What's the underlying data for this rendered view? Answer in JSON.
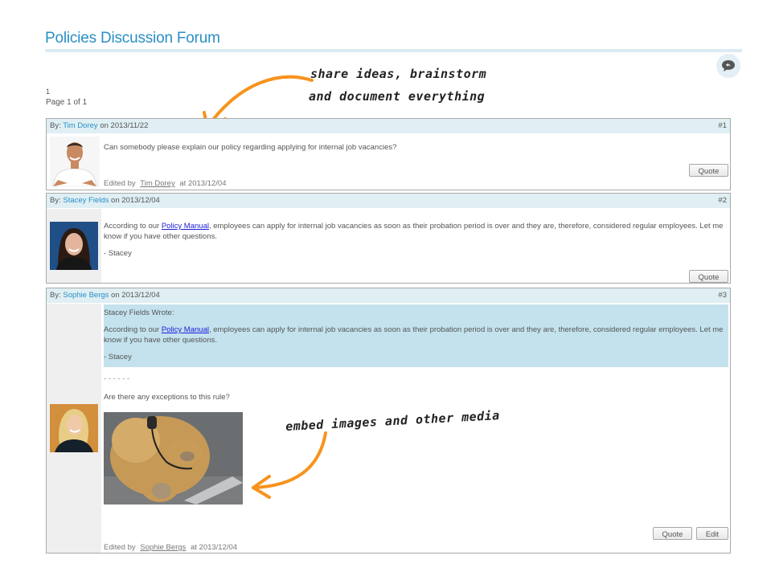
{
  "page": {
    "title": "Policies Discussion Forum",
    "pager_number": "1",
    "pager_text": "Page 1 of 1"
  },
  "annotations": {
    "top_line1": "share ideas, brainstorm",
    "top_line2": "and document everything",
    "bottom": "embed images and other media",
    "arrow_color": "#f7931e"
  },
  "colors": {
    "accent": "#2a8fc6",
    "header_bg": "#dfeff4",
    "quote_bg": "#c3e2ed",
    "link": "#1a1ad8"
  },
  "posts": [
    {
      "by_label": "By:",
      "author": "Tim Dorey",
      "on_label": "on",
      "date": "2013/11/22",
      "number": "#1",
      "body": "Can somebody please explain our policy regarding applying for internal job vacancies?",
      "edited_label": "Edited by",
      "edited_by": "Tim Dorey",
      "edited_at_label": "at",
      "edited_at": "2013/12/04",
      "buttons": [
        "Quote"
      ]
    },
    {
      "by_label": "By:",
      "author": "Stacey Fields",
      "on_label": "on",
      "date": "2013/12/04",
      "number": "#2",
      "body_pre": "According to our ",
      "body_link": "Policy Manual",
      "body_post": ", employees can apply for internal job vacancies as soon as their probation period is over and they are, therefore, considered regular employees. Let me know if you have other questions.",
      "signature": "- Stacey",
      "buttons": [
        "Quote"
      ]
    },
    {
      "by_label": "By:",
      "author": "Sophie Bergs",
      "on_label": "on",
      "date": "2013/12/04",
      "number": "#3",
      "quote_header": "Stacey Fields Wrote:",
      "quote_pre": "According to our ",
      "quote_link": "Policy Manual",
      "quote_post": ", employees can apply for internal job vacancies as soon as their probation period is over and they are, therefore, considered regular employees. Let me know if you have other questions.",
      "quote_signature": "- Stacey",
      "separator": "- - - - - -",
      "body": "Are there any exceptions to this rule?",
      "image_alt": "teddy bear with headset on laptop",
      "edited_label": "Edited by",
      "edited_by": "Sophie Bergs",
      "edited_at_label": "at",
      "edited_at": "2013/12/04",
      "buttons": [
        "Quote",
        "Edit"
      ]
    }
  ]
}
